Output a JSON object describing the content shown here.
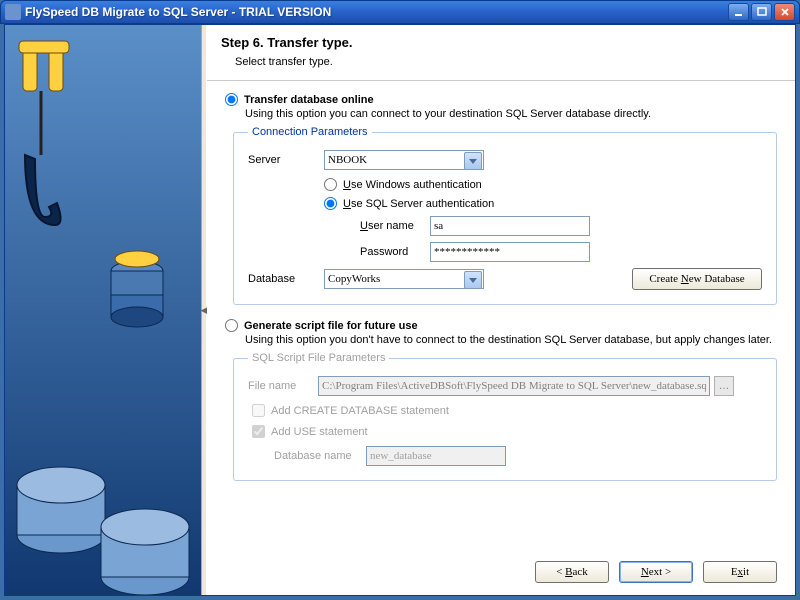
{
  "window": {
    "title": "FlySpeed DB Migrate to SQL Server - TRIAL VERSION"
  },
  "header": {
    "title": "Step 6. Transfer type.",
    "subtitle": "Select transfer type."
  },
  "option1": {
    "label": "Transfer database online",
    "desc": "Using this option you can connect to your destination SQL Server database directly.",
    "checked": true,
    "group": {
      "legend": "Connection Parameters",
      "server_label": "Server",
      "server_value": "NBOOK",
      "auth_win": "Use Windows authentication",
      "auth_sql": "Use SQL Server authentication",
      "auth_sql_checked": true,
      "user_label": "User name",
      "user_value": "sa",
      "pass_label": "Password",
      "pass_value": "************",
      "db_label": "Database",
      "db_value": "CopyWorks",
      "create_btn": "Create New Database"
    }
  },
  "option2": {
    "label": "Generate script file for future use",
    "desc": "Using this option you don't have to connect to the destination SQL Server database, but apply changes later.",
    "checked": false,
    "group": {
      "legend": "SQL Script File Parameters",
      "file_label": "File name",
      "file_value": "C:\\Program Files\\ActiveDBSoft\\FlySpeed DB Migrate to SQL Server\\new_database.sql",
      "add_create": "Add CREATE DATABASE statement",
      "add_use": "Add USE statement",
      "add_use_checked": true,
      "dbn_label": "Database name",
      "dbn_value": "new_database"
    }
  },
  "nav": {
    "back": "< Back",
    "next": "Next >",
    "exit": "Exit"
  }
}
